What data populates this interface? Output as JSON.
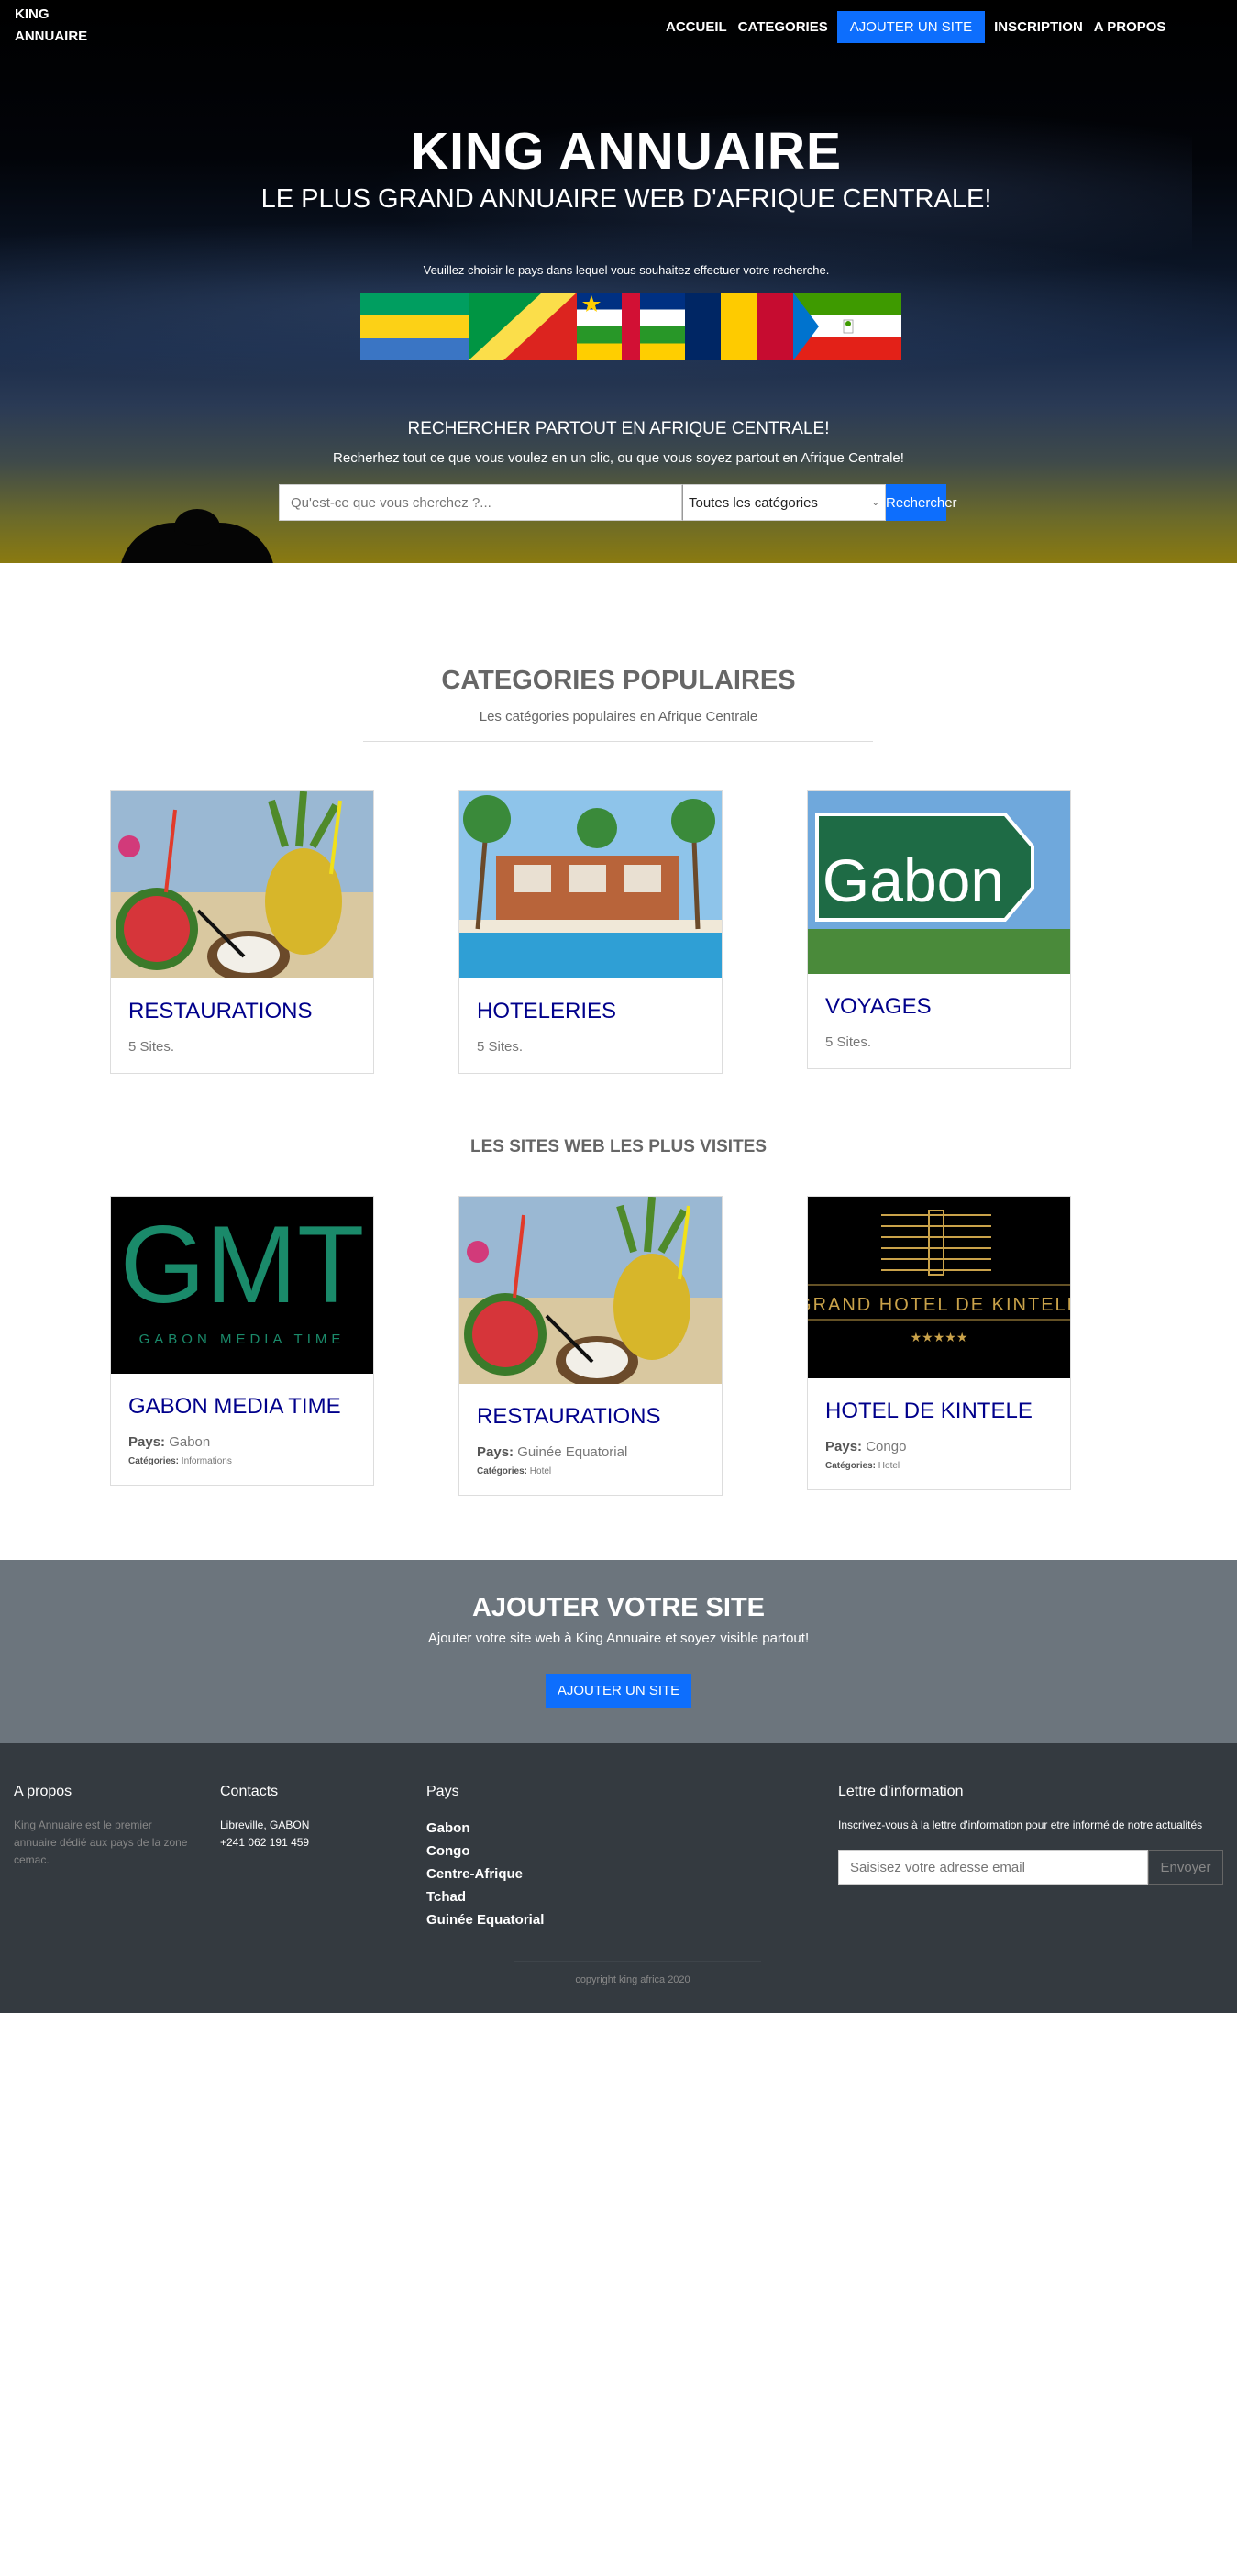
{
  "nav": {
    "brand": "KING ANNUAIRE",
    "items": [
      "ACCUEIL",
      "CATEGORIES",
      "AJOUTER UN SITE",
      "INSCRIPTION",
      "A PROPOS"
    ]
  },
  "hero": {
    "title": "KING ANNUAIRE",
    "subtitle": "LE PLUS GRAND ANNUAIRE WEB D'AFRIQUE CENTRALE!",
    "choose_text": "Veuillez choisir le pays dans lequel vous souhaitez effectuer votre recherche.",
    "flags": [
      "Gabon",
      "Congo",
      "Centre-Afrique",
      "Tchad",
      "Guinée Equatorial"
    ],
    "search_title": "RECHERCHER PARTOUT EN AFRIQUE CENTRALE!",
    "search_subtitle": "Recherhez tout ce que vous voulez en un clic, ou que vous soyez partout en Afrique Centrale!",
    "search_placeholder": "Qu'est-ce que vous cherchez ?...",
    "category_select": "Toutes les catégories",
    "search_button": "Rechercher"
  },
  "categories": {
    "title": "CATEGORIES POPULAIRES",
    "subtitle": "Les catégories populaires en Afrique Centrale",
    "items": [
      {
        "name": "RESTAURATIONS",
        "count": "5 Sites."
      },
      {
        "name": "HOTELERIES",
        "count": "5 Sites."
      },
      {
        "name": "VOYAGES",
        "count": "5 Sites."
      }
    ]
  },
  "visits": {
    "title": "LES SITES WEB LES PLUS VISITES",
    "items": [
      {
        "name": "GABON MEDIA TIME",
        "country_label": "Pays:",
        "country": "Gabon",
        "cat_label": "Catégories:",
        "category": "Informations",
        "image_text": "GMT",
        "image_sub": "GABON MEDIA TIME"
      },
      {
        "name": "RESTAURATIONS",
        "country_label": "Pays:",
        "country": "Guinée Equatorial",
        "cat_label": "Catégories:",
        "category": "Hotel"
      },
      {
        "name": "HOTEL DE KINTELE",
        "country_label": "Pays:",
        "country": "Congo",
        "cat_label": "Catégories:",
        "category": "Hotel",
        "image_text": "GRAND HOTEL DE KINTELE",
        "image_stars": "★★★★★"
      }
    ]
  },
  "voyages_image_text": "Gabon",
  "add_site": {
    "title": "AJOUTER VOTRE SITE",
    "text": "Ajouter votre site web à King Annuaire et soyez visible partout!",
    "button": "AJOUTER UN SITE"
  },
  "footer": {
    "about_title": "A propos",
    "about_text": "King Annuaire est le premier annuaire dédié aux pays de la zone cemac.",
    "contacts_title": "Contacts",
    "address": "Libreville, GABON",
    "phone": "+241 062 191 459",
    "countries_title": "Pays",
    "countries": [
      "Gabon",
      "Congo",
      "Centre-Afrique",
      "Tchad",
      "Guinée Equatorial"
    ],
    "newsletter_title": "Lettre d'information",
    "newsletter_text": "Inscrivez-vous à la lettre d'information pour etre informé de notre actualités",
    "email_placeholder": "Saisisez votre adresse email",
    "send_button": "Envoyer",
    "copyright": "copyright king africa 2020"
  },
  "colors": {
    "primary": "#0d6efd",
    "card_title": "#00008b",
    "add_bg": "#6c757d",
    "footer_bg": "#343a40"
  }
}
